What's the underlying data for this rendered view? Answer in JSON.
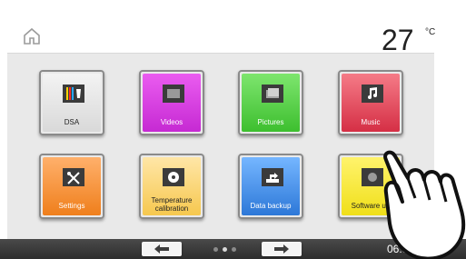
{
  "header": {
    "home_icon": "home-icon",
    "temperature": "27",
    "temperature_unit": "°C"
  },
  "tiles": [
    {
      "label": "DSA",
      "color": "#d9d9d9",
      "icon": "dsa-icon"
    },
    {
      "label": "Videos",
      "color": "#c62ad3",
      "icon": "video-icon"
    },
    {
      "label": "Pictures",
      "color": "#3dbf2f",
      "icon": "pictures-icon"
    },
    {
      "label": "Music",
      "color": "#d52f45",
      "icon": "music-icon"
    },
    {
      "label": "Settings",
      "color": "#ef7f1c",
      "icon": "settings-icon"
    },
    {
      "label_line1": "Temperature",
      "label_line2": "calibration",
      "color": "#f6c84f",
      "icon": "calibration-icon"
    },
    {
      "label": "Data backup",
      "color": "#2d78d8",
      "icon": "backup-icon"
    },
    {
      "label": "Software up",
      "color": "#f0df19",
      "icon": "software-update-icon"
    }
  ],
  "footer": {
    "prev_icon": "arrow-left-icon",
    "next_icon": "arrow-right-icon",
    "page_dots": 3,
    "active_dot": 1,
    "time": "06:07:34"
  }
}
